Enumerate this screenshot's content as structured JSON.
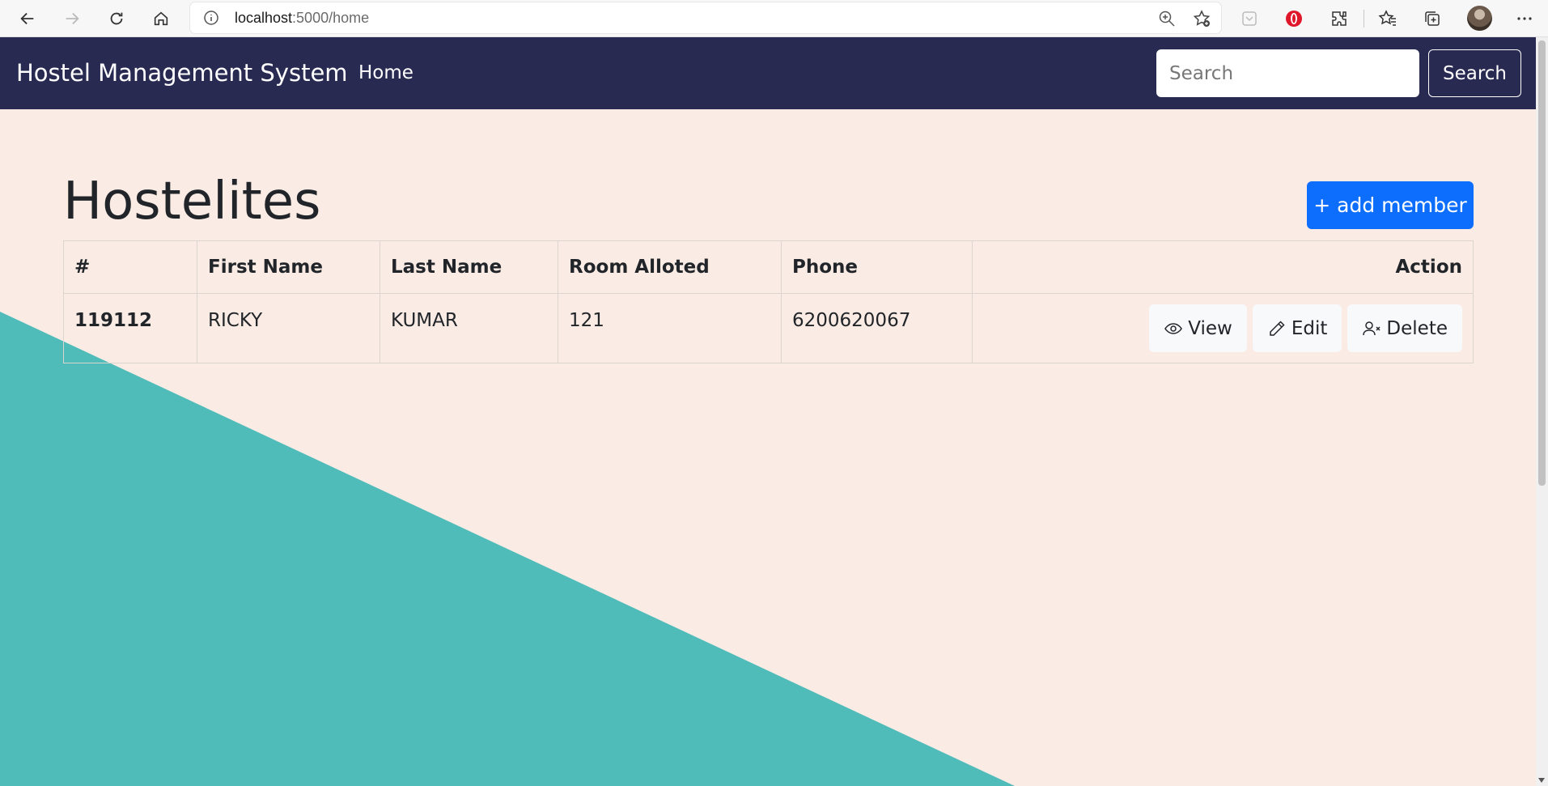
{
  "browser": {
    "url_host": "localhost",
    "url_path": ":5000/home"
  },
  "navbar": {
    "brand": "Hostel Management System",
    "home_link": "Home",
    "search_placeholder": "Search",
    "search_button": "Search"
  },
  "page": {
    "title": "Hostelites",
    "add_button": "+ add member"
  },
  "table": {
    "headers": [
      "#",
      "First Name",
      "Last Name",
      "Room Alloted",
      "Phone",
      "Action"
    ],
    "rows": [
      {
        "id": "119112",
        "first_name": "RICKY",
        "last_name": "KUMAR",
        "room": "121",
        "phone": "6200620067",
        "actions": {
          "view": "View",
          "edit": "Edit",
          "delete": "Delete"
        }
      }
    ]
  },
  "colors": {
    "navbar_bg": "#282a52",
    "page_bg": "#faece5",
    "teal": "#50bcba",
    "primary_button": "#0d6efd"
  },
  "icons": [
    "back-arrow-icon",
    "forward-arrow-icon",
    "reload-icon",
    "home-icon",
    "info-icon",
    "zoom-icon",
    "add-favorite-icon",
    "eye-icon",
    "pencil-icon",
    "user-x-icon"
  ]
}
